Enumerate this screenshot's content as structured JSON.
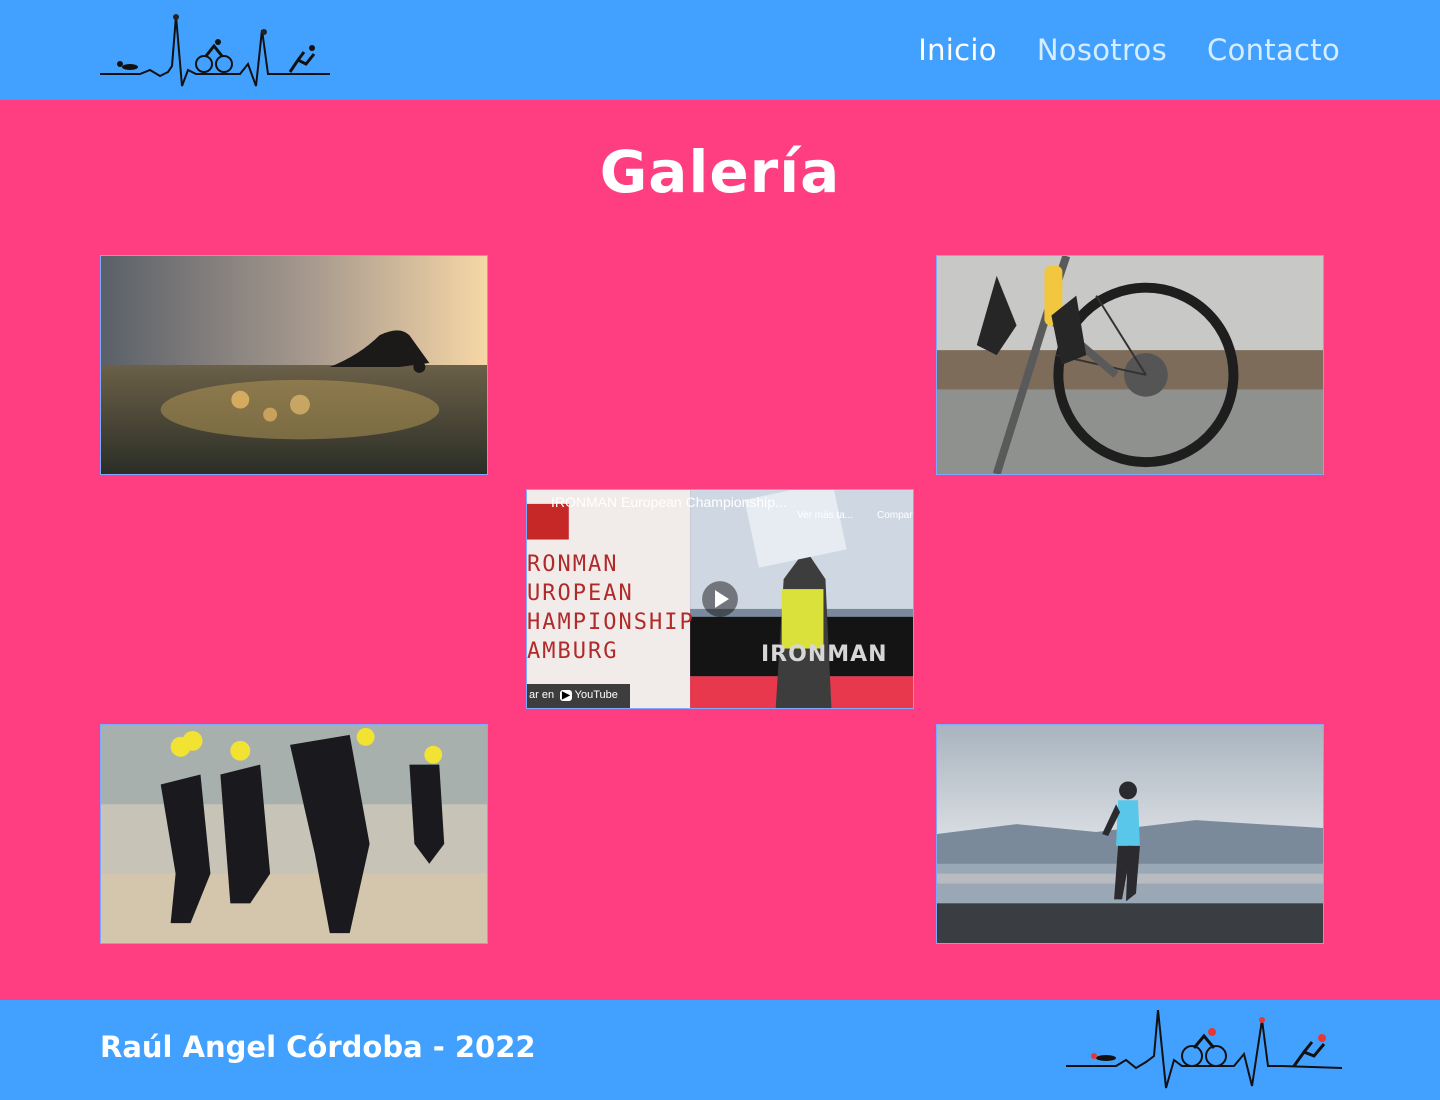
{
  "header": {
    "nav": [
      {
        "label": "Inicio",
        "active": true
      },
      {
        "label": "Nosotros",
        "active": false
      },
      {
        "label": "Contacto",
        "active": false
      }
    ],
    "logo_icon": "triathlon-heartbeat-logo"
  },
  "main": {
    "title": "Galería",
    "gallery": [
      {
        "icon": "swimmer-photo"
      },
      {
        "icon": "bicycle-photo"
      },
      {
        "icon": "youtube-video",
        "video_title": "IRONMAN European Championship...",
        "more_label": "Ver más ta...",
        "share_label": "Compar",
        "brand_lines": "RONMAN\nUROPEAN\nHAMPIONSHIP\nAMBURG",
        "watch_label": "ar en",
        "youtube_label": "YouTube",
        "banner_text": "IRONMAN"
      },
      {
        "icon": "open-water-swimmers-photo"
      },
      {
        "icon": "runner-photo"
      }
    ]
  },
  "footer": {
    "text": "Raúl Angel Córdoba - 2022"
  },
  "colors": {
    "header_bg": "#42a1ff",
    "page_bg": "#ff3e81",
    "text": "#ffffff"
  }
}
